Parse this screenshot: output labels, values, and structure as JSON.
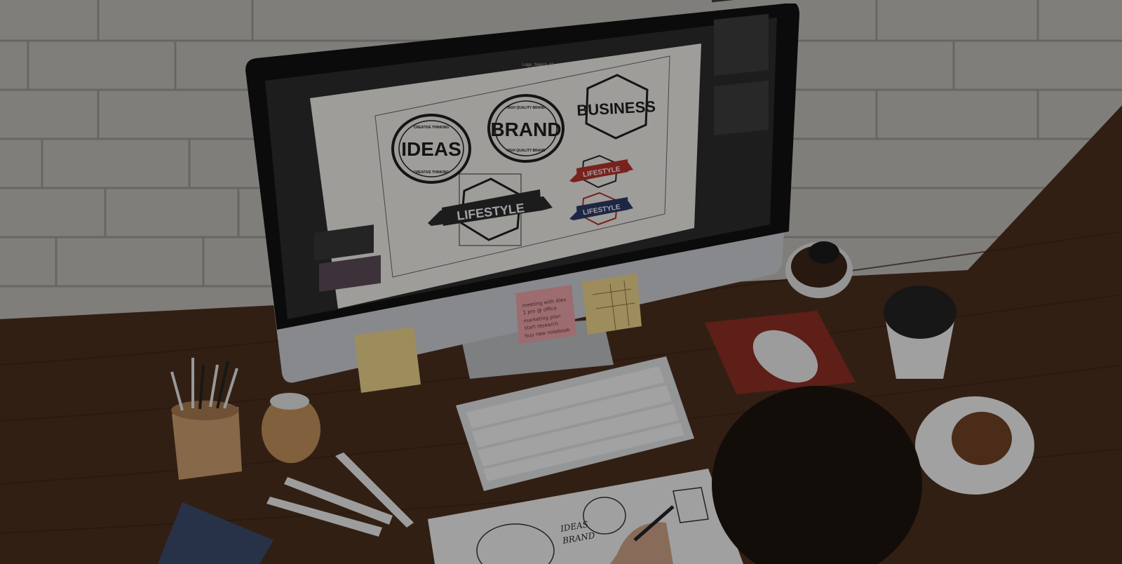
{
  "screen": {
    "window_title": "Logo_Sketch_01"
  },
  "logos": {
    "ideas": {
      "main": "IDEAS",
      "top_arc": "CREATIVE THINKING",
      "bottom_arc": "CREATIVE THINKING"
    },
    "brand": {
      "main": "BRAND",
      "top_arc": "HIGH QUALITY BRAND",
      "bottom_arc": "HIGH QUALITY BRAND"
    },
    "business": {
      "main": "BUSINESS"
    },
    "lifestyle_selected": {
      "main": "LIFESTYLE"
    },
    "lifestyle_red": {
      "main": "LIFESTYLE"
    },
    "lifestyle_blue": {
      "main": "LIFESTYLE"
    }
  },
  "sticky_note": {
    "line1": "meeting with Alex",
    "line2": "1 pm @ office",
    "line3": "marketing plan",
    "line4": "start research",
    "line5": "buy new notebook"
  },
  "sketchbook": {
    "word1": "IDEAS",
    "word2": "BRAND"
  },
  "colors": {
    "desk": "#4a2e1e",
    "wall": "#bdbab5",
    "logo_red": "#b3322b",
    "logo_blue": "#2c3a63",
    "sticky_pink": "#e8a0a6",
    "sticky_yellow": "#e8d08a"
  }
}
